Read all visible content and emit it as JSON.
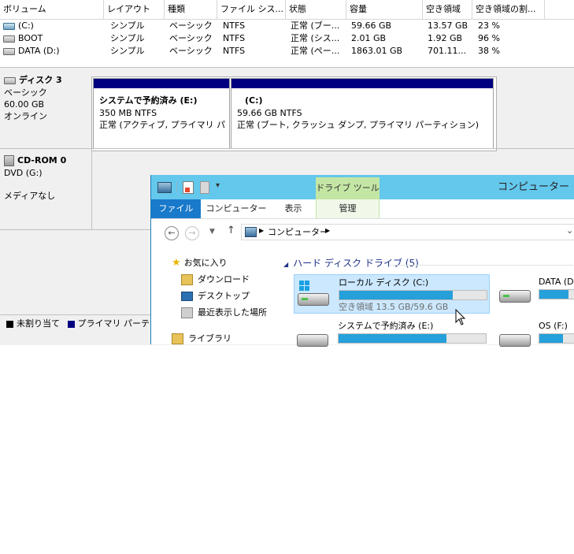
{
  "volume_table": {
    "headers": [
      "ボリューム",
      "レイアウト",
      "種類",
      "ファイル シス...",
      "状態",
      "容量",
      "空き領域",
      "空き領域の割..."
    ],
    "rows": [
      {
        "name": "(C:)",
        "layout": "シンプル",
        "type": "ベーシック",
        "fs": "NTFS",
        "status": "正常 (ブー...",
        "capacity": "59.66 GB",
        "free": "13.57 GB",
        "pct": "23 %",
        "icon": "volume-system-icon"
      },
      {
        "name": "BOOT",
        "layout": "シンプル",
        "type": "ベーシック",
        "fs": "NTFS",
        "status": "正常 (シス...",
        "capacity": "2.01 GB",
        "free": "1.92 GB",
        "pct": "96 %",
        "icon": "volume-icon"
      },
      {
        "name": "DATA (D:)",
        "layout": "シンプル",
        "type": "ベーシック",
        "fs": "NTFS",
        "status": "正常 (ペー...",
        "capacity": "1863.01 GB",
        "free": "701.11...",
        "pct": "38 %",
        "icon": "volume-icon"
      }
    ]
  },
  "disks": [
    {
      "name": "ディスク 3",
      "type": "ベーシック",
      "size": "60.00 GB",
      "state": "オンライン",
      "partitions": [
        {
          "title": "システムで予約済み (E:)",
          "size": "350 MB NTFS",
          "status": "正常 (アクティブ, プライマリ パーティ"
        },
        {
          "title": "(C:)",
          "size": "59.66 GB NTFS",
          "status": "正常 (ブート, クラッシュ ダンプ, プライマリ パーティション)"
        }
      ]
    },
    {
      "name": "CD-ROM 0",
      "type": "DVD (G:)",
      "state": "メディアなし"
    }
  ],
  "legend": {
    "unallocated": "未割り当て",
    "primary": "プライマリ パーティシ"
  },
  "explorer": {
    "title": "コンピューター",
    "context_tab": "ドライブ ツール",
    "tabs": [
      "ファイル",
      "コンピューター",
      "表示",
      "管理"
    ],
    "breadcrumb": "コンピューター",
    "nav": {
      "favorites": "お気に入り",
      "items": [
        "ダウンロード",
        "デスクトップ",
        "最近表示した場所"
      ],
      "next": "ライブラリ"
    },
    "group_header": "ハード ディスク ドライブ (5)",
    "drives": [
      {
        "name": "ローカル ディスク (C:)",
        "free_text": "空き領域 13.5 GB/59.6 GB",
        "used_fraction": 0.77,
        "selected": true
      },
      {
        "name": "DATA (D:)",
        "used_fraction": 0.62
      },
      {
        "name": "システムで予約済み (E:)",
        "used_fraction": 0.73
      },
      {
        "name": "OS (F:)",
        "used_fraction": 0.5
      }
    ]
  },
  "colors": {
    "primary_partition": "#000080",
    "ribbon": "#64c7ec",
    "file_tab": "#1979ca",
    "drive_fill": "#26a0da",
    "selection": "#cce8ff"
  }
}
